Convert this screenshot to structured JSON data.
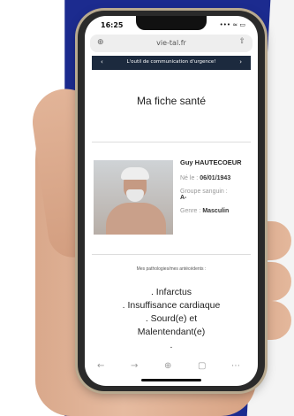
{
  "status": {
    "time": "16:25",
    "icons": "••• ≈ ▭"
  },
  "browser": {
    "left_icon": "⊕",
    "url": "vie-tal.fr",
    "right_icon": "⇧"
  },
  "banner": {
    "prev": "‹",
    "text": "L'outil de communication d'urgence!",
    "next": "›"
  },
  "page": {
    "title": "Ma fiche santé",
    "name": "Guy HAUTECOEUR",
    "birth_label": "Né le :",
    "birth_value": "06/01/1943",
    "blood_label": "Groupe sanguin :",
    "blood_value": "A-",
    "gender_label": "Genre :",
    "gender_value": "Masculin",
    "pathologies_label": "Mes pathologies/mes antécédents :",
    "pathologies": [
      ". Infarctus",
      ". Insuffisance cardiaque",
      ". Sourd(e) et",
      "Malentendant(e)",
      "."
    ]
  },
  "toolbar": {
    "back": "←",
    "forward": "→",
    "add": "⊕",
    "tabs": "▢",
    "more": "⋯"
  },
  "colors": {
    "navy": "#1c2b8f",
    "banner": "#1c2a3e"
  }
}
